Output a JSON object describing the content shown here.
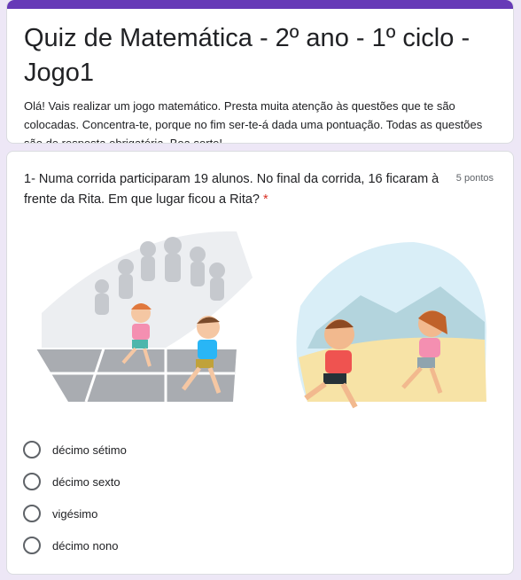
{
  "form": {
    "title": "Quiz de Matemática - 2º ano - 1º ciclo - Jogo1",
    "description": "Olá! Vais realizar um jogo matemático. Presta muita atenção às questões que te são colocadas. Concentra-te, porque no fim ser-te-á dada uma pontuação. Todas as questões são de resposta obrigatória. Boa sorte!",
    "accent_color": "#673ab7",
    "background_color": "#ede7f6"
  },
  "question": {
    "text": "1- Numa corrida participaram 19 alunos. No final da corrida, 16 ficaram à frente da Rita. Em que lugar ficou a Rita?",
    "required_marker": "*",
    "points": "5 pontos",
    "options": [
      "décimo sétimo",
      "décimo sexto",
      "vigésimo",
      "décimo nono"
    ]
  }
}
